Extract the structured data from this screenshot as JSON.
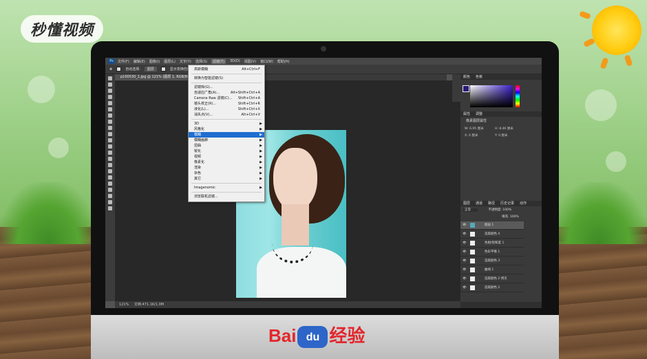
{
  "logo": {
    "text": "秒懂视频"
  },
  "brand": {
    "baidu_left": "Bai",
    "baidu_paw": "du",
    "baidu_right": "经验"
  },
  "ps": {
    "menubar": [
      "文件(F)",
      "编辑(E)",
      "图像(I)",
      "图层(L)",
      "文字(Y)",
      "选择(S)",
      "滤镜(T)",
      "3D(D)",
      "视图(V)",
      "窗口(W)",
      "帮助(H)"
    ],
    "active_menu_index": 6,
    "options": {
      "auto_select_label": "自动选择:",
      "auto_select_value": "图层",
      "show_transform": "显示变换控件"
    },
    "doc_tab": "p100530_1.jpg @ 121% (图层 1, RGB/8#) ×",
    "status": {
      "zoom": "121%",
      "doc": "文档:471.1K/1.0M"
    }
  },
  "filter_menu": {
    "items": [
      {
        "label": "高斯模糊",
        "shortcut": "Alt+Ctrl+F"
      },
      {
        "sep": true
      },
      {
        "label": "转换为智能滤镜(S)"
      },
      {
        "sep": true
      },
      {
        "label": "滤镜库(G)..."
      },
      {
        "label": "自适应广角(A)...",
        "shortcut": "Alt+Shift+Ctrl+A"
      },
      {
        "label": "Camera Raw 滤镜(C)...",
        "shortcut": "Shift+Ctrl+A"
      },
      {
        "label": "镜头校正(R)...",
        "shortcut": "Shift+Ctrl+R"
      },
      {
        "label": "液化(L)...",
        "shortcut": "Shift+Ctrl+X"
      },
      {
        "label": "消失点(V)...",
        "shortcut": "Alt+Ctrl+V"
      },
      {
        "sep": true
      },
      {
        "label": "3D",
        "submenu": true
      },
      {
        "label": "风格化",
        "submenu": true
      },
      {
        "label": "模糊",
        "submenu": true,
        "highlighted": true
      },
      {
        "label": "模糊画廊",
        "submenu": true
      },
      {
        "label": "扭曲",
        "submenu": true
      },
      {
        "label": "锐化",
        "submenu": true
      },
      {
        "label": "视频",
        "submenu": true
      },
      {
        "label": "像素化",
        "submenu": true
      },
      {
        "label": "渲染",
        "submenu": true
      },
      {
        "label": "杂色",
        "submenu": true
      },
      {
        "label": "其它",
        "submenu": true
      },
      {
        "sep": true
      },
      {
        "label": "Imagenomic",
        "submenu": true
      },
      {
        "sep": true
      },
      {
        "label": "浏览联机滤镜..."
      }
    ]
  },
  "panels": {
    "color_tabs": [
      "颜色",
      "色板"
    ],
    "props_tabs": [
      "属性",
      "调整"
    ],
    "props_title": "像素图层属性",
    "props_fields": [
      "W: 6.95 厘米",
      "H: 8.46 厘米",
      "X: 0 厘米",
      "Y: 0 厘米"
    ],
    "layers_tabs": [
      "图层",
      "通道",
      "路径",
      "历史记录",
      "动作"
    ],
    "blend": "正常",
    "opacity": "不透明度: 100%",
    "fill": "填充: 100%",
    "layers": [
      {
        "name": "图层 1",
        "selected": true,
        "image": true
      },
      {
        "name": "选取颜色 4"
      },
      {
        "name": "色相/饱和度 1"
      },
      {
        "name": "色彩平衡 1"
      },
      {
        "name": "选取颜色 3"
      },
      {
        "name": "曲线 1"
      },
      {
        "name": "选取颜色 2 拷贝"
      },
      {
        "name": "选取颜色 2"
      }
    ]
  },
  "colors": {
    "highlight": "#1f6ed0",
    "menu_bg": "#f0f0f0",
    "baidu_red": "#e3262c",
    "baidu_blue": "#2d65c8"
  }
}
